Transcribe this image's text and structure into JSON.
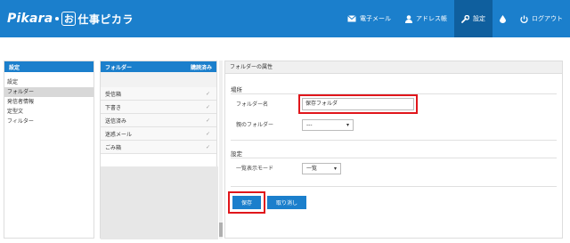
{
  "header": {
    "logo_brand": "Pikara",
    "logo_mark": "お",
    "logo_service": "仕事ピカラ",
    "nav": [
      {
        "label": "電子メール",
        "icon": "mail-icon"
      },
      {
        "label": "アドレス帳",
        "icon": "user-icon"
      },
      {
        "label": "設定",
        "icon": "wrench-icon",
        "active": true
      },
      {
        "label": "",
        "icon": "drop-icon"
      },
      {
        "label": "ログアウト",
        "icon": "power-icon"
      }
    ]
  },
  "settings_panel": {
    "title": "設定",
    "items": [
      "設定",
      "フォルダー",
      "発信者情報",
      "定型文",
      "フィルター"
    ],
    "active_index": 1
  },
  "folder_panel": {
    "title": "フォルダー",
    "subscribed_label": "購読済み",
    "folders": [
      "受信箱",
      "下書き",
      "送信済み",
      "迷惑メール",
      "ごみ箱"
    ],
    "check_glyph": "✓"
  },
  "properties_panel": {
    "title": "フォルダーの属性",
    "location_section": "場所",
    "folder_name_label": "フォルダー名",
    "folder_name_value": "保存フォルダ",
    "parent_folder_label": "親のフォルダー",
    "parent_folder_value": "---",
    "settings_section": "設定",
    "list_mode_label": "一覧表示モード",
    "list_mode_value": "一覧",
    "save_label": "保存",
    "cancel_label": "取り消し"
  },
  "colors": {
    "brand": "#1b7fcc",
    "nav_active": "#0f5f9e",
    "highlight": "#e0161b"
  }
}
